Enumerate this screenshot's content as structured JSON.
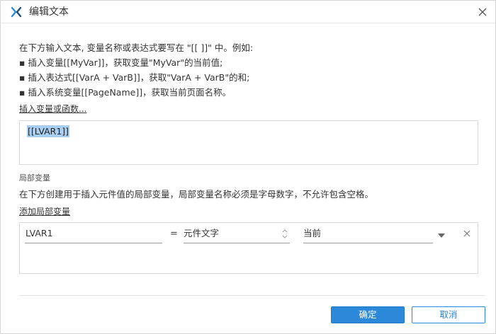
{
  "window": {
    "title": "编辑文本",
    "logo_icon": "axure-x-logo-icon",
    "close_icon": "close-icon"
  },
  "intro": {
    "lines": [
      "在下方输入文本, 变量名称或表达式要写在 \"[[ ]]\" 中。例如:",
      "▪ 插入变量[[MyVar]]，获取变量\"MyVar\"的当前值;",
      "▪ 插入表达式[[VarA + VarB]]，获取\"VarA + VarB\"的和;",
      "▪ 插入系统变量[[PageName]]，获取当前页面名称。"
    ]
  },
  "insert_link": "插入变量或函数...",
  "text_area": {
    "value": "[[LVAR1]]"
  },
  "local_vars": {
    "section_label": "局部变量",
    "description": "在下方创建用于插入元件值的局部变量，局部变量名称必须是字母数字，不允许包含空格。",
    "add_link": "添加局部变量",
    "rows": [
      {
        "name": "LVAR1",
        "equals": "=",
        "type": "元件文字",
        "target": "当前"
      }
    ]
  },
  "buttons": {
    "ok": "确定",
    "cancel": "取消"
  },
  "colors": {
    "primary": "#2c89d9",
    "selection": "#a8cff1",
    "logo_blue": "#2f8fd8",
    "logo_dark": "#1f4f7a"
  }
}
